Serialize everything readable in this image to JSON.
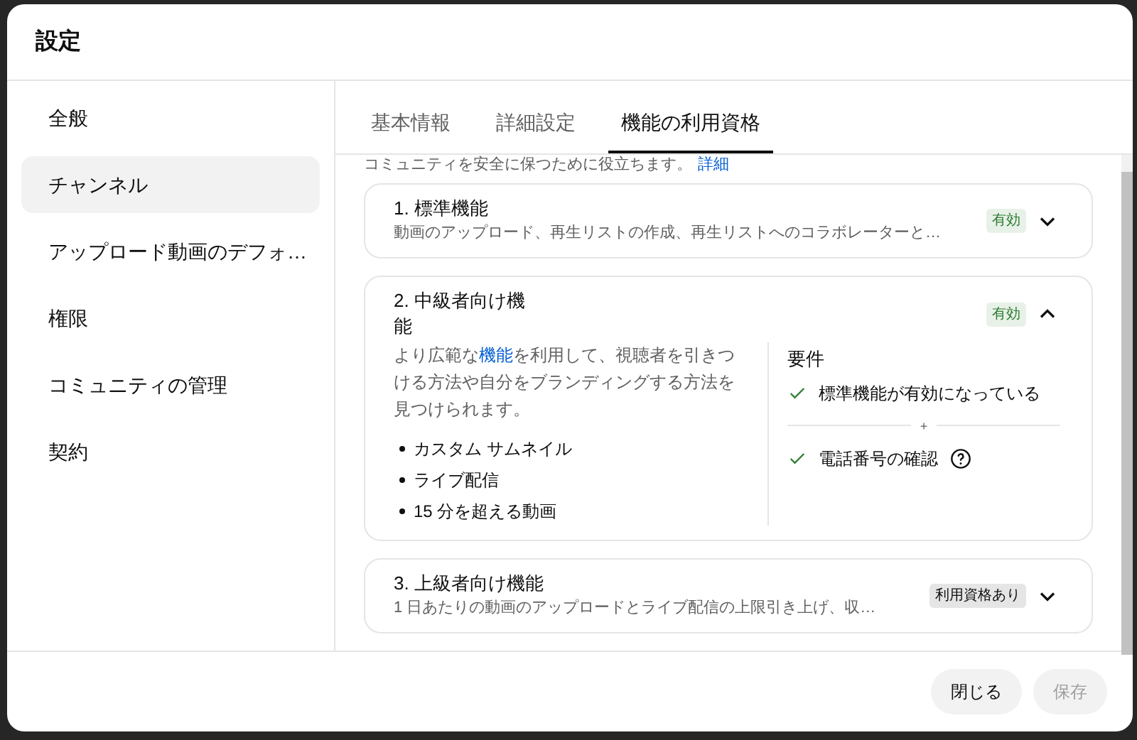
{
  "dialog": {
    "title": "設定"
  },
  "sidebar": {
    "items": [
      {
        "label": "全般",
        "selected": false
      },
      {
        "label": "チャンネル",
        "selected": true
      },
      {
        "label": "アップロード動画のデフォ…",
        "selected": false
      },
      {
        "label": "権限",
        "selected": false
      },
      {
        "label": "コミュニティの管理",
        "selected": false
      },
      {
        "label": "契約",
        "selected": false
      }
    ]
  },
  "tabs": [
    {
      "label": "基本情報",
      "selected": false
    },
    {
      "label": "詳細設定",
      "selected": false
    },
    {
      "label": "機能の利用資格",
      "selected": true
    }
  ],
  "intro": {
    "text": "コミュニティを安全に保つために役立ちます。",
    "link": "詳細"
  },
  "features": [
    {
      "title": "1. 標準機能",
      "summary": "動画のアップロード、再生リストの作成、再生リストへのコラボレーターと…",
      "badge": "有効",
      "color": "#2e7d32",
      "expanded": false
    },
    {
      "title": "2. 中級者向け機能",
      "description_before": "より広範な",
      "description_link": "機能",
      "description_after": "を利用して、視聴者を引きつける方法や自分をブランディングする方法を見つけられます。",
      "badge": "有効",
      "color": "#2e7d32",
      "expanded": true,
      "bullets": [
        "カスタム サムネイル",
        "ライブ配信",
        "15 分を超える動画"
      ],
      "requirements_title": "要件",
      "requirements": [
        {
          "label": "標準機能が有効になっている",
          "met": true,
          "help": false
        },
        {
          "label": "電話番号の確認",
          "met": true,
          "help": true
        }
      ],
      "separator": "+"
    },
    {
      "title": "3. 上級者向け機能",
      "summary": "1 日あたりの動画のアップロードとライブ配信の上限引き上げ、収…",
      "badge": "利用資格あり",
      "color": "#0f0f0f",
      "expanded": false
    }
  ],
  "footer": {
    "buttons": [
      {
        "label": "閉じる",
        "disabled": false
      },
      {
        "label": "保存",
        "disabled": true
      }
    ]
  }
}
